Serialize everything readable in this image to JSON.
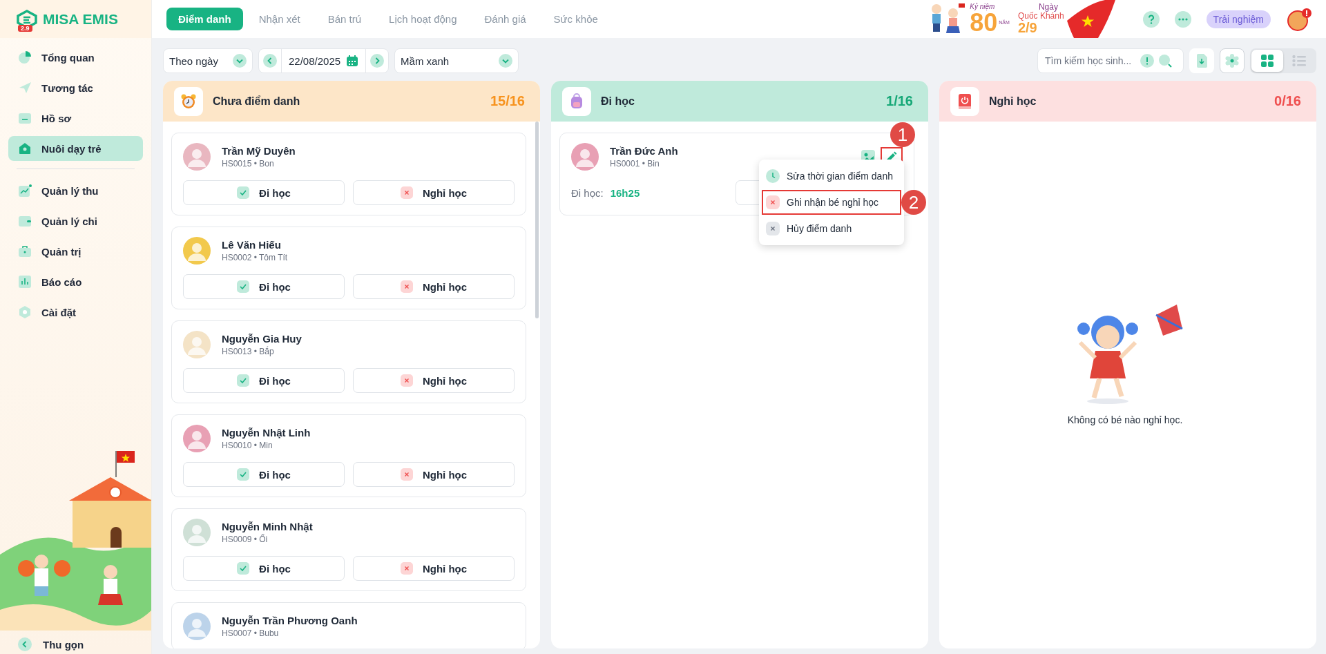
{
  "sidebar": {
    "logo": {
      "name": "MISA EMIS",
      "badge": "2.9"
    },
    "groups": [
      [
        {
          "label": "Tổng quan",
          "selected": false
        },
        {
          "label": "Tương tác",
          "selected": false
        },
        {
          "label": "Hồ sơ",
          "selected": false
        },
        {
          "label": "Nuôi dạy trẻ",
          "selected": true
        }
      ],
      [
        {
          "label": "Quản lý thu",
          "selected": false
        },
        {
          "label": "Quản lý chi",
          "selected": false
        },
        {
          "label": "Quản trị",
          "selected": false
        },
        {
          "label": "Báo cáo",
          "selected": false
        },
        {
          "label": "Cài đặt",
          "selected": false
        }
      ]
    ],
    "collapse": "Thu gọn"
  },
  "tabs": [
    {
      "label": "Điểm danh",
      "selected": true
    },
    {
      "label": "Nhận xét",
      "selected": false
    },
    {
      "label": "Bán trú",
      "selected": false
    },
    {
      "label": "Lịch hoạt động",
      "selected": false
    },
    {
      "label": "Đánh giá",
      "selected": false
    },
    {
      "label": "Sức khỏe",
      "selected": false
    }
  ],
  "banner": {
    "top": "Kỷ niệm",
    "number": "80",
    "unit": "NĂM",
    "line1": "Ngày",
    "line2": "Quốc Khánh",
    "date": "2/9"
  },
  "header": {
    "trial": "Trải nghiệm"
  },
  "toolbar": {
    "mode": "Theo ngày",
    "date": "22/08/2025",
    "class": "Mầm xanh",
    "search": {
      "placeholder": "Tìm kiếm học sinh..."
    },
    "views": [
      {
        "kind": "grid",
        "selected": true
      },
      {
        "kind": "list",
        "selected": false
      }
    ]
  },
  "columns": [
    {
      "kind": "pending",
      "title": "Chưa điểm danh",
      "count": "15/16",
      "students": [
        {
          "name": "Trần Mỹ Duyên",
          "meta": "HS0015 • Bon",
          "actions": [
            "Đi học",
            "Nghỉ học"
          ]
        },
        {
          "name": "Lê Văn Hiếu",
          "meta": "HS0002 • Tôm Tít",
          "actions": [
            "Đi học",
            "Nghỉ học"
          ]
        },
        {
          "name": "Nguyễn Gia Huy",
          "meta": "HS0013 • Bắp",
          "actions": [
            "Đi học",
            "Nghỉ học"
          ]
        },
        {
          "name": "Nguyễn Nhật Linh",
          "meta": "HS0010 • Min",
          "actions": [
            "Đi học",
            "Nghỉ học"
          ]
        },
        {
          "name": "Nguyễn Minh Nhật",
          "meta": "HS0009 • Ổi",
          "actions": [
            "Đi học",
            "Nghỉ học"
          ]
        },
        {
          "name": "Nguyễn Trần Phương Oanh",
          "meta": "HS0007 • Bubu"
        }
      ]
    },
    {
      "kind": "present",
      "title": "Đi học",
      "count": "1/16",
      "students": [
        {
          "name": "Trần Đức Anh",
          "meta": "HS0001 • Bin",
          "time_label": "Đi học:",
          "time": "16h25",
          "edit_highlighted": true,
          "edit_callout": "1",
          "menu": [
            {
              "kind": "time",
              "label": "Sửa thời gian điểm danh",
              "highlighted": false
            },
            {
              "kind": "absent",
              "label": "Ghi nhận bé nghỉ học",
              "highlighted": true,
              "callout": "2"
            },
            {
              "kind": "cancel",
              "label": "Hủy điểm danh",
              "highlighted": false
            }
          ]
        }
      ]
    },
    {
      "kind": "absent",
      "title": "Nghỉ học",
      "count": "0/16",
      "empty": "Không có bé nào nghỉ học."
    }
  ]
}
